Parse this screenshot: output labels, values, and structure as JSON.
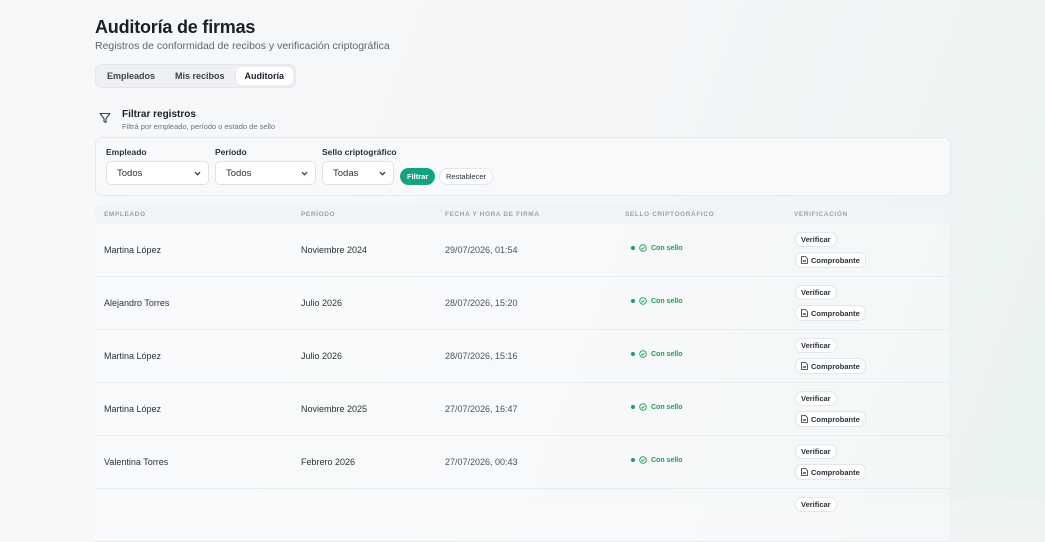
{
  "header": {
    "title": "Auditoría de firmas",
    "subtitle": "Registros de conformidad de recibos y verificación criptográfica"
  },
  "tabs": [
    {
      "label": "Empleados",
      "active": false
    },
    {
      "label": "Mis recibos",
      "active": false
    },
    {
      "label": "Auditoría",
      "active": true
    }
  ],
  "filter": {
    "title": "Filtrar registros",
    "subtitle": "Filtrá por empleado, período o estado de sello",
    "icon": "filter-funnel-icon",
    "fields": [
      {
        "label": "Empleado",
        "value": "Todos"
      },
      {
        "label": "Período",
        "value": "Todos"
      },
      {
        "label": "Sello criptográfico",
        "value": "Todas"
      }
    ],
    "apply_label": "Filtrar",
    "reset_label": "Restablecer",
    "accent_color": "#14a37f"
  },
  "table": {
    "columns": [
      "EMPLEADO",
      "PERÍODO",
      "FECHA Y HORA DE FIRMA",
      "SELLO CRIPTOGRÁFICO",
      "VERIFICACIÓN"
    ],
    "verify_label": "Verificar",
    "receipt_label": "Comprobante",
    "seal_color": "#1f9d55",
    "rows": [
      {
        "employee": "Martina López",
        "period": "Noviembre 2024",
        "signed_at": "29/07/2026, 01:54",
        "seal": "Con sello"
      },
      {
        "employee": "Alejandro Torres",
        "period": "Julio 2026",
        "signed_at": "28/07/2026, 15:20",
        "seal": "Con sello"
      },
      {
        "employee": "Martina López",
        "period": "Julio 2026",
        "signed_at": "28/07/2026, 15:16",
        "seal": "Con sello"
      },
      {
        "employee": "Martina López",
        "period": "Noviembre 2025",
        "signed_at": "27/07/2026, 16:47",
        "seal": "Con sello"
      },
      {
        "employee": "Valentina Torres",
        "period": "Febrero 2026",
        "signed_at": "27/07/2026, 00:43",
        "seal": "Con sello"
      },
      {
        "employee": "",
        "period": "",
        "signed_at": "",
        "seal": ""
      }
    ]
  }
}
